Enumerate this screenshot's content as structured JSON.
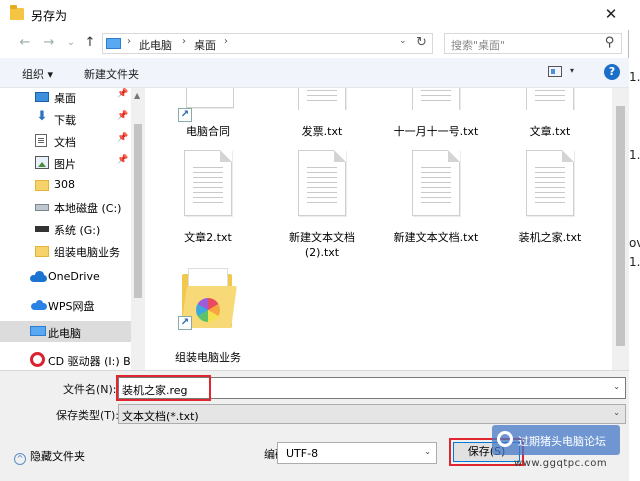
{
  "window": {
    "title": "另存为",
    "close": "✕"
  },
  "nav": {
    "back": "←",
    "forward": "→",
    "recent": "⌄",
    "up": "↑"
  },
  "address": {
    "crumbs": [
      "此电脑",
      "桌面"
    ],
    "sep": "›",
    "dropdown": "⌄",
    "refresh": "↻"
  },
  "search": {
    "placeholder": "搜索\"桌面\"",
    "icon": "⚲"
  },
  "toolbar": {
    "organize": "组织 ▾",
    "new_folder": "新建文件夹",
    "view_dd": "▾",
    "help": "?"
  },
  "sidebar": {
    "items": [
      {
        "label": "桌面",
        "pin": "📌"
      },
      {
        "label": "下载",
        "pin": "📌",
        "icon": "⬇"
      },
      {
        "label": "文档",
        "pin": "📌"
      },
      {
        "label": "图片",
        "pin": "📌"
      },
      {
        "label": "308"
      },
      {
        "label": "本地磁盘 (C:)"
      },
      {
        "label": "系统 (G:)"
      },
      {
        "label": "组装电脑业务"
      },
      {
        "label": "OneDrive"
      },
      {
        "label": "WPS网盘"
      },
      {
        "label": "此电脑"
      },
      {
        "label": "CD 驱动器 (I:) BC"
      }
    ],
    "scroll_up": "▲"
  },
  "files": [
    {
      "name": "电脑合同"
    },
    {
      "name": "发票.txt"
    },
    {
      "name": "十一月十一号.txt"
    },
    {
      "name": "文章.txt"
    },
    {
      "name": "文章2.txt"
    },
    {
      "name": "新建文本文档\n(2).txt"
    },
    {
      "name": "新建文本文档.txt"
    },
    {
      "name": "装机之家.txt"
    },
    {
      "name": "组装电脑业务"
    }
  ],
  "shortcut_glyph": "↗",
  "form": {
    "filename_label": "文件名(N):",
    "filename_value": "装机之家.reg",
    "filetype_label": "保存类型(T):",
    "filetype_value": "文本文档(*.txt)",
    "dd": "⌄",
    "hide_folders": "隐藏文件夹",
    "hide_chev": "^",
    "encoding_label": "编码(E):",
    "encoding_value": "UTF-8",
    "save": "保存(S)"
  },
  "watermark": {
    "text": "过期猪头电脑论坛",
    "url": "www.ggqtpc.com"
  },
  "background_edge": [
    "1.",
    "1.",
    "ov",
    "1."
  ],
  "colors": {
    "accent": "#0078d7",
    "highlight": "#e0262e",
    "folder": "#f0c84e"
  }
}
